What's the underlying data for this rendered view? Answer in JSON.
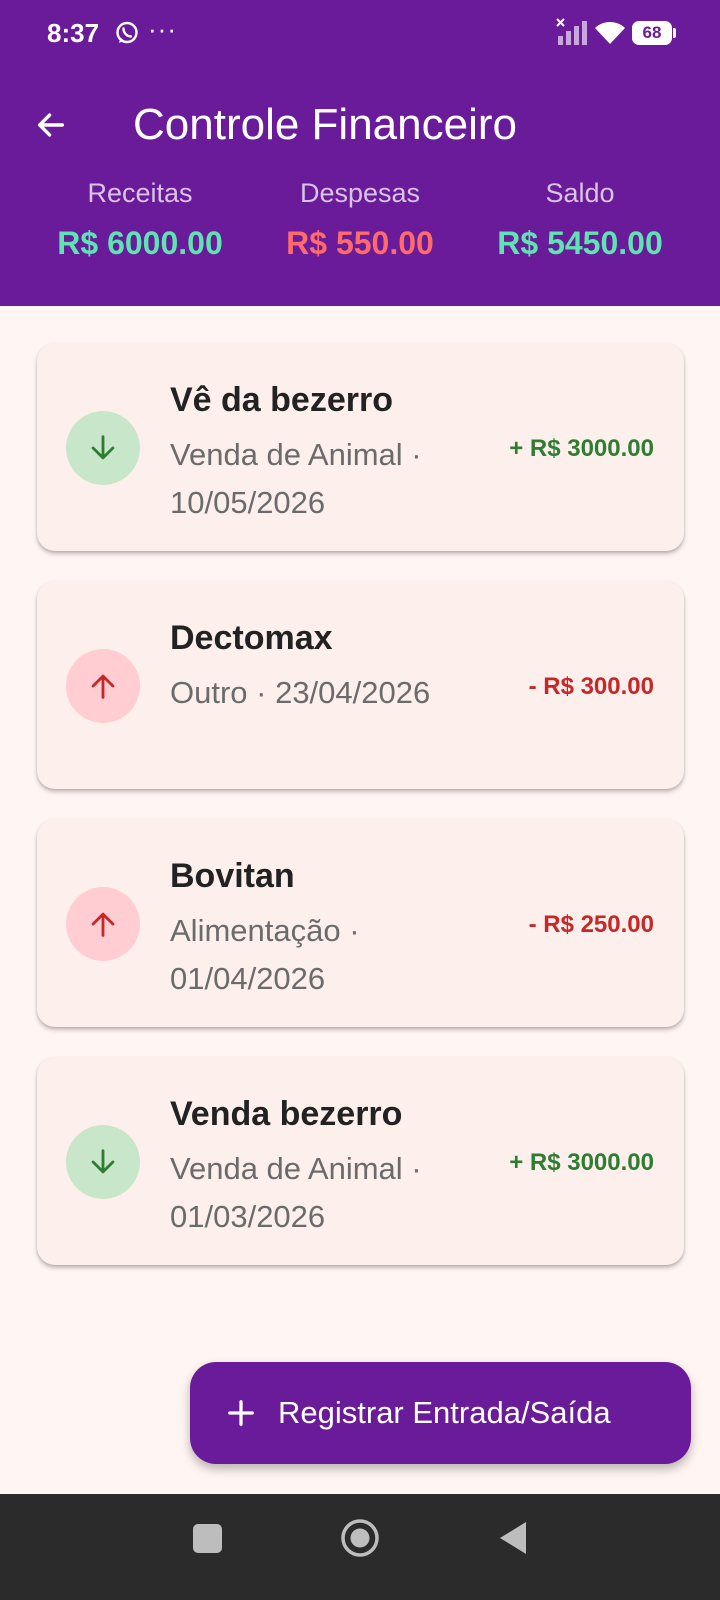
{
  "status_bar": {
    "time": "8:37",
    "dots": "···",
    "battery": "68"
  },
  "header": {
    "title": "Controle Financeiro",
    "summary": [
      {
        "label": "Receitas",
        "value": "R$ 6000.00",
        "color": "#5FE3B3"
      },
      {
        "label": "Despesas",
        "value": "R$ 550.00",
        "color": "#FF6B6B"
      },
      {
        "label": "Saldo",
        "value": "R$ 5450.00",
        "color": "#5FE3B3"
      }
    ]
  },
  "transactions": [
    {
      "title": "Vê da bezerro",
      "subtitle": "Venda de Animal · 10/05/2026",
      "amount": "+ R$ 3000.00",
      "type": "income",
      "icon": "arrow-down-icon"
    },
    {
      "title": "Dectomax",
      "subtitle": "Outro · 23/04/2026",
      "amount": "- R$ 300.00",
      "type": "expense",
      "icon": "arrow-up-icon"
    },
    {
      "title": "Bovitan",
      "subtitle": "Alimentação · 01/04/2026",
      "amount": "- R$ 250.00",
      "type": "expense",
      "icon": "arrow-up-icon"
    },
    {
      "title": "Venda bezerro",
      "subtitle": "Venda de Animal · 01/03/2026",
      "amount": "+ R$ 3000.00",
      "type": "income",
      "icon": "arrow-down-icon"
    }
  ],
  "fab": {
    "label": "Registrar Entrada/Saída",
    "icon": "plus-icon"
  },
  "colors": {
    "primary": "#6A1B9A",
    "income": "#2E7D32",
    "expense": "#C62828",
    "income_bg": "#C8E6C9",
    "expense_bg": "#FFCDD2",
    "card_bg": "#FDEFEC",
    "page_bg": "#FFF5F3"
  }
}
